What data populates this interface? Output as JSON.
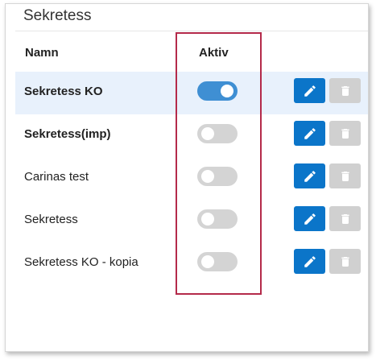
{
  "panel": {
    "title": "Sekretess"
  },
  "table": {
    "headers": {
      "name": "Namn",
      "active": "Aktiv"
    },
    "rows": [
      {
        "name": "Sekretess KO",
        "active": true,
        "bold": true,
        "selected": true
      },
      {
        "name": "Sekretess(imp)",
        "active": false,
        "bold": true,
        "selected": false
      },
      {
        "name": "Carinas test",
        "active": false,
        "bold": false,
        "selected": false
      },
      {
        "name": "Sekretess",
        "active": false,
        "bold": false,
        "selected": false
      },
      {
        "name": "Sekretess KO - kopia",
        "active": false,
        "bold": false,
        "selected": false
      }
    ]
  },
  "icons": {
    "edit": "pencil-icon",
    "delete": "trash-icon"
  },
  "colors": {
    "edit_button": "#0b75c9",
    "delete_button_disabled": "#d0d0d0",
    "toggle_on": "#3f8fd3",
    "toggle_off": "#d4d4d4",
    "selected_row": "#e8f1fc",
    "highlight_border": "#b42a4a"
  }
}
